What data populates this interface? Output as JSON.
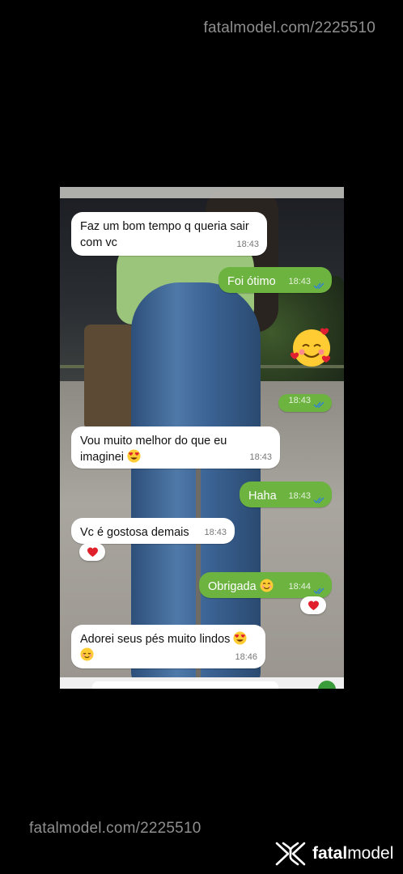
{
  "watermark": {
    "top": "fatalmodel.com/2225510",
    "bottom": "fatalmodel.com/2225510"
  },
  "brand": {
    "name_bold": "fatal",
    "name_regular": "model",
    "logo_icon": "fatalmodel-logo-icon"
  },
  "colors": {
    "outgoing_bubble": "#6cb33f",
    "incoming_bubble": "#ffffff",
    "background": "#000000"
  },
  "messages": [
    {
      "dir": "in",
      "text": "Faz um bom tempo q queria sair com vc",
      "time": "18:43"
    },
    {
      "dir": "out",
      "text": "Foi ótimo",
      "time": "18:43",
      "status": "read"
    },
    {
      "dir": "out",
      "emoji": "smiling-face-with-hearts",
      "time": "18:43",
      "status": "read"
    },
    {
      "dir": "in",
      "text": "Vou muito melhor do que eu imaginei",
      "emoji": "heart-eyes",
      "time": "18:43"
    },
    {
      "dir": "out",
      "text": "Haha",
      "time": "18:43",
      "status": "read"
    },
    {
      "dir": "in",
      "text": "Vc é gostosa demais",
      "time": "18:43",
      "reaction": "red-heart"
    },
    {
      "dir": "out",
      "text": "Obrigada",
      "emoji": "smiling-face",
      "time": "18:44",
      "status": "read",
      "reaction": "red-heart"
    },
    {
      "dir": "in",
      "text": "Adorei seus pés muito lindos",
      "emoji": "heart-eyes",
      "emoji2": "relieved-face",
      "time": "18:46"
    }
  ]
}
